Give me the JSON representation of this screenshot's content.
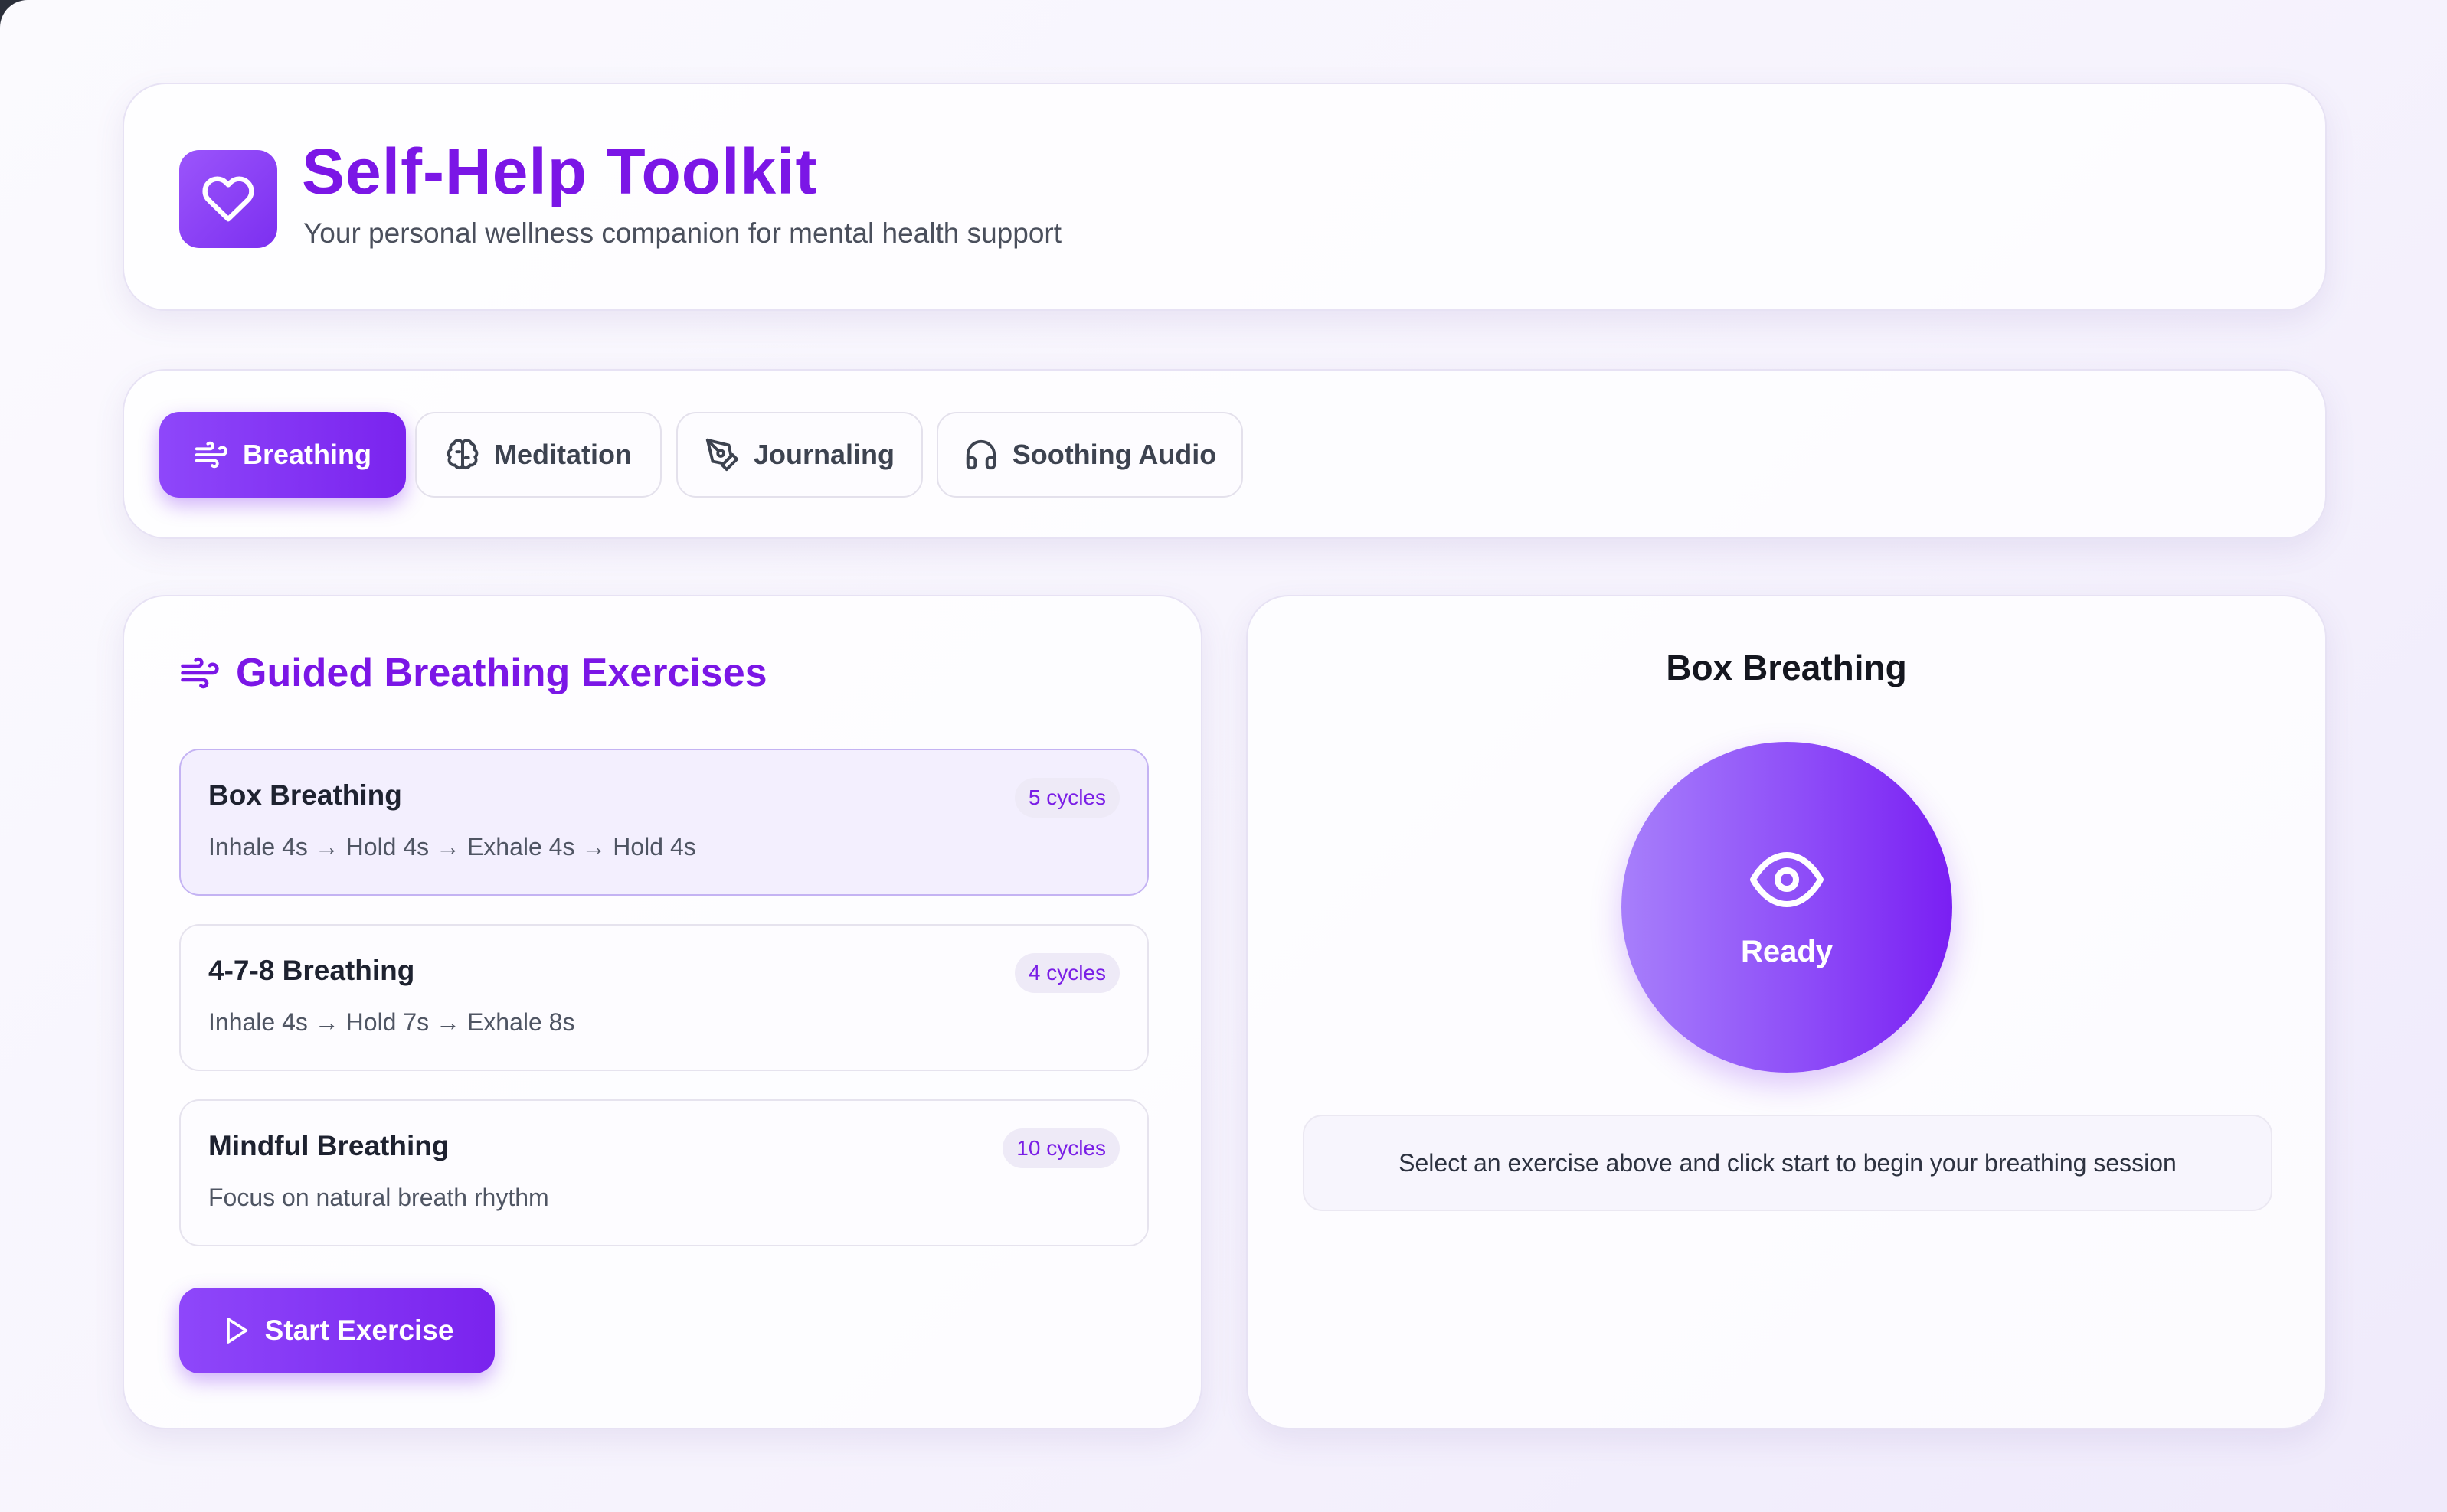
{
  "app": {
    "title": "Self-Help Toolkit",
    "subtitle": "Your personal wellness companion for mental health support",
    "logo_icon": "heart-icon"
  },
  "tabs": [
    {
      "label": "Breathing",
      "icon": "wind-icon",
      "active": true
    },
    {
      "label": "Meditation",
      "icon": "brain-icon",
      "active": false
    },
    {
      "label": "Journaling",
      "icon": "pen-tool-icon",
      "active": false
    },
    {
      "label": "Soothing Audio",
      "icon": "headphones-icon",
      "active": false
    }
  ],
  "exercises_panel": {
    "title": "Guided Breathing Exercises",
    "icon": "wind-icon",
    "items": [
      {
        "name": "Box Breathing",
        "description": "Inhale 4s → Hold 4s → Exhale 4s → Hold 4s",
        "badge": "5 cycles",
        "selected": true
      },
      {
        "name": "4-7-8 Breathing",
        "description": "Inhale 4s → Hold 7s → Exhale 8s",
        "badge": "4 cycles",
        "selected": false
      },
      {
        "name": "Mindful Breathing",
        "description": "Focus on natural breath rhythm",
        "badge": "10 cycles",
        "selected": false
      }
    ],
    "start_label": "Start Exercise",
    "start_icon": "play-icon"
  },
  "session_panel": {
    "title": "Box Breathing",
    "status": "Ready",
    "status_icon": "eye-icon",
    "instruction": "Select an exercise above and click start to begin your breathing session"
  },
  "colors": {
    "accent": "#7b16e6",
    "accent_gradient_start": "#8e47fa",
    "accent_gradient_end": "#7a23ee",
    "selected_bg": "#f3effe"
  }
}
